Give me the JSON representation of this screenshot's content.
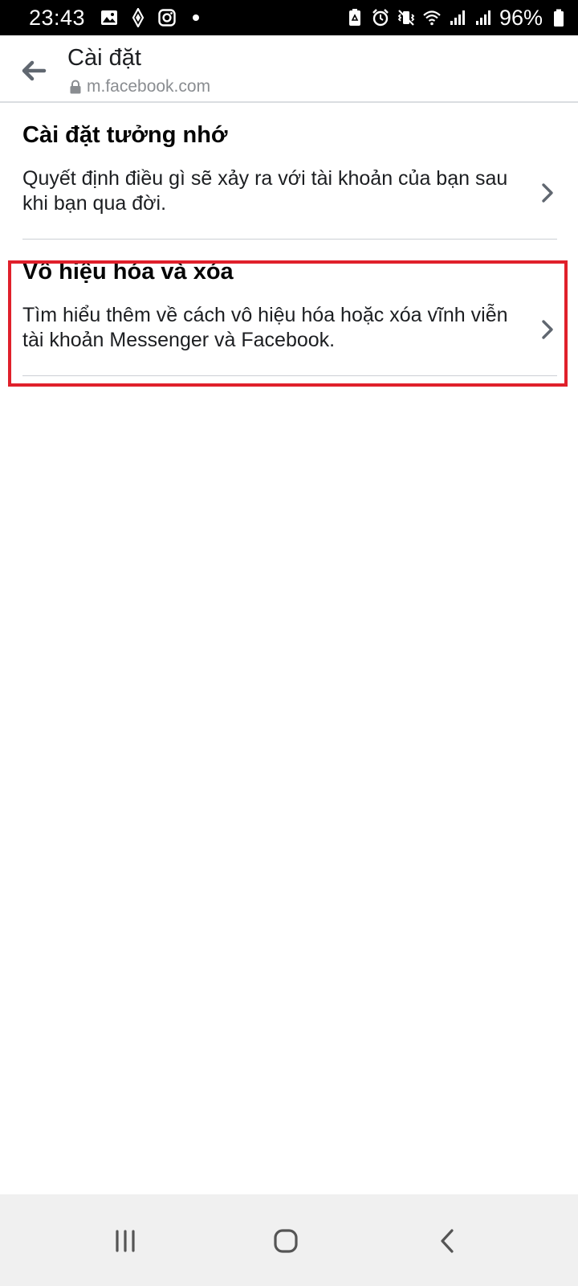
{
  "status_bar": {
    "time": "23:43",
    "battery_percent": "96%",
    "left_icons": [
      "gallery-icon",
      "location-pin-icon",
      "instagram-icon",
      "dot-icon"
    ],
    "right_icons": [
      "battery-saver-icon",
      "alarm-icon",
      "vibrate-icon",
      "wifi-icon",
      "signal-icon",
      "signal-icon",
      "battery-icon"
    ]
  },
  "header": {
    "title": "Cài đặt",
    "url": "m.facebook.com"
  },
  "items": [
    {
      "title": "Cài đặt tưởng nhớ",
      "description": "Quyết định điều gì sẽ xảy ra với tài khoản của bạn sau khi bạn qua đời."
    },
    {
      "title": "Vô hiệu hóa và xóa",
      "description": "Tìm hiểu thêm về cách vô hiệu hóa hoặc xóa vĩnh viễn tài khoản Messenger và Facebook."
    }
  ],
  "colors": {
    "highlight": "#e0202b",
    "icon_gray": "#606770",
    "divider": "#ccd0d5"
  },
  "nav_bar": {
    "buttons": [
      "recents-icon",
      "home-icon",
      "back-icon"
    ]
  }
}
